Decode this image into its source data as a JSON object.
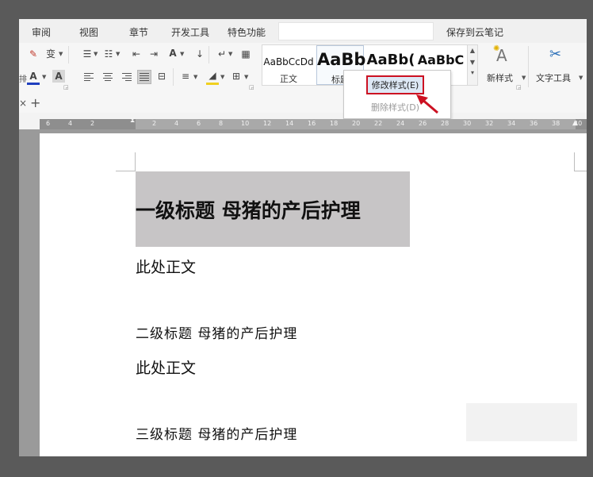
{
  "menubar": {
    "items": [
      "审阅",
      "视图",
      "章节",
      "开发工具",
      "特色功能",
      "保存到云笔记"
    ]
  },
  "ribbon": {
    "styles": [
      {
        "sample": "AaBbCcDd",
        "label": "正文"
      },
      {
        "sample": "AaBb",
        "label": "标题"
      },
      {
        "sample": "AaBb(",
        "label": ""
      },
      {
        "sample": "AaBbC",
        "label": ""
      }
    ],
    "new_style": "新样式",
    "text_tools": "文字工具",
    "left_edge_text": "排"
  },
  "context_menu": {
    "modify": "修改样式(E)",
    "delete": "删除样式(D)"
  },
  "tabstrip": {
    "close": "×",
    "add": "+"
  },
  "ruler": {
    "left_ticks": [
      "6",
      "4",
      "2"
    ],
    "right_ticks": [
      "2",
      "4",
      "6",
      "8",
      "10",
      "12",
      "14",
      "16",
      "18",
      "20",
      "22",
      "24",
      "26",
      "28",
      "30",
      "32",
      "34",
      "36",
      "38",
      "40"
    ]
  },
  "document": {
    "h1": "一级标题  母猪的产后护理",
    "body1": "此处正文",
    "h2": "二级标题 母猪的产后护理",
    "body2": "此处正文",
    "h3": "三级标题 母猪的产后护理"
  },
  "colors": {
    "accent_red": "#cc1122",
    "heading_highlight": "#c7c5c6",
    "font_color_bar": "#1f3fbf",
    "highlight_bar": "#f0d020"
  }
}
